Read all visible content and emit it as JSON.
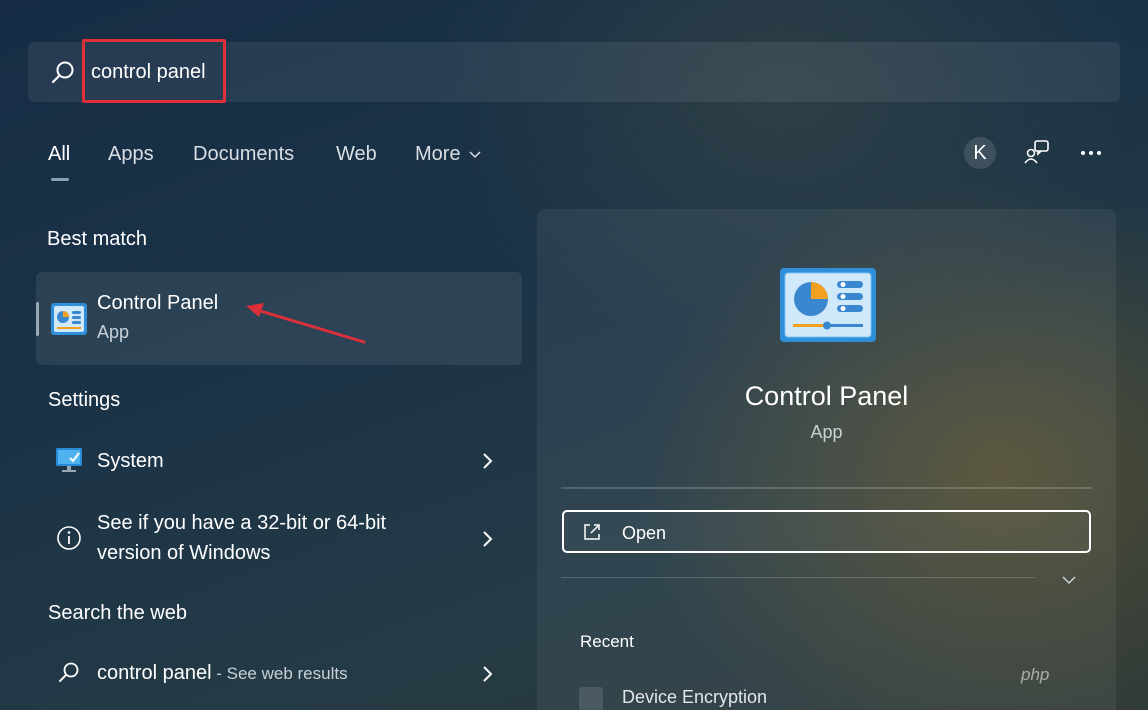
{
  "search": {
    "value": "control panel",
    "icon": "search-icon"
  },
  "tabs": [
    {
      "label": "All",
      "active": true
    },
    {
      "label": "Apps"
    },
    {
      "label": "Documents"
    },
    {
      "label": "Web"
    },
    {
      "label": "More"
    }
  ],
  "toolbar": {
    "avatar_letter": "K",
    "feedback_icon": "feedback-icon",
    "more_icon": "more-icon"
  },
  "best_match": {
    "title": "Best match",
    "item": {
      "name": "Control Panel",
      "type": "App",
      "icon": "control-panel-icon"
    }
  },
  "settings": {
    "title": "Settings",
    "items": [
      {
        "label": "System",
        "icon": "monitor-icon"
      },
      {
        "label_line1": "See if you have a 32-bit or 64-bit",
        "label_line2": "version of Windows",
        "icon": "info-icon"
      }
    ]
  },
  "web": {
    "title": "Search the web",
    "item": {
      "query": "control panel",
      "suffix": " - See web results",
      "icon": "search-icon"
    }
  },
  "details": {
    "name": "Control Panel",
    "type": "App",
    "open_label": "Open",
    "recent_title": "Recent",
    "recent_items": [
      {
        "label": "Device Encryption"
      }
    ]
  },
  "watermark": "php",
  "colors": {
    "highlight": "#e0313b",
    "annotation_arrow": "#d9303a"
  }
}
